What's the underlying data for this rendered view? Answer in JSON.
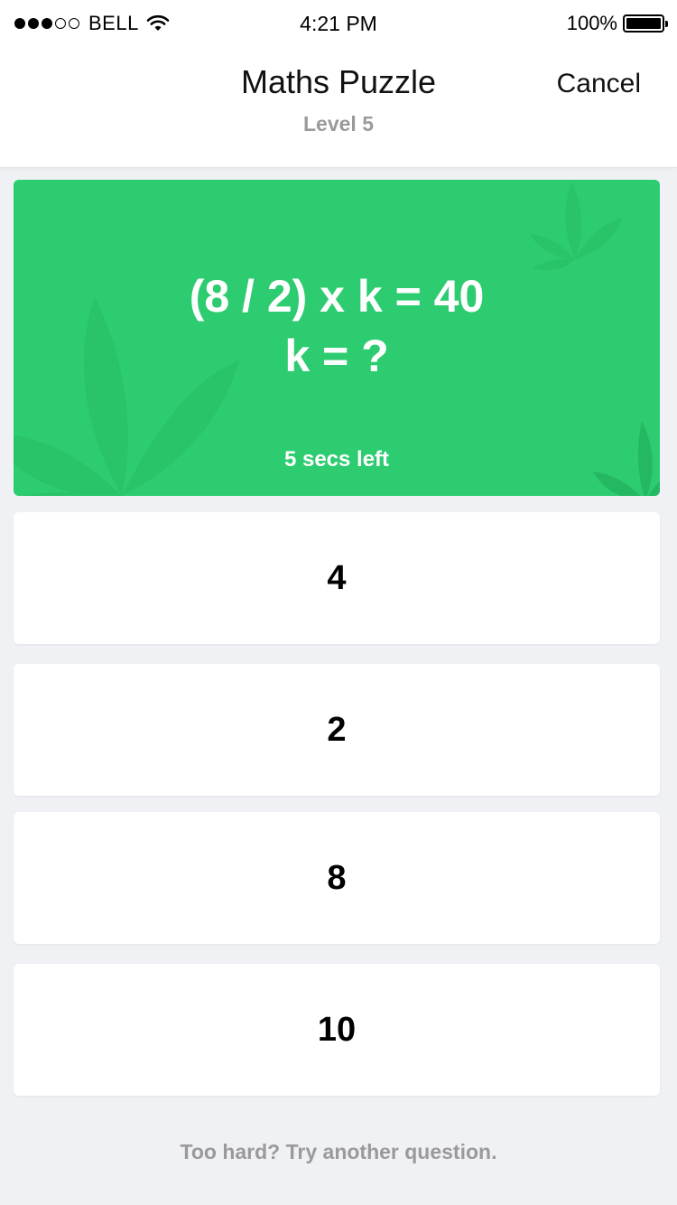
{
  "status_bar": {
    "carrier": "BELL",
    "time": "4:21 PM",
    "battery_percent": "100%",
    "signal_strength": "3 of 5",
    "battery_level": 1.0
  },
  "nav": {
    "title": "Maths Puzzle",
    "subtitle": "Level 5",
    "cancel_label": "Cancel"
  },
  "question": {
    "line1": "(8 / 2) x k = 40",
    "line2": "k = ?",
    "timer": "5 secs left",
    "background_color": "#2ecc71",
    "decoration_icon": "leaf-icon"
  },
  "answers": [
    {
      "label": "4"
    },
    {
      "label": "2"
    },
    {
      "label": "8"
    },
    {
      "label": "10"
    }
  ],
  "footer": {
    "link_text": "Too hard? Try another question."
  }
}
